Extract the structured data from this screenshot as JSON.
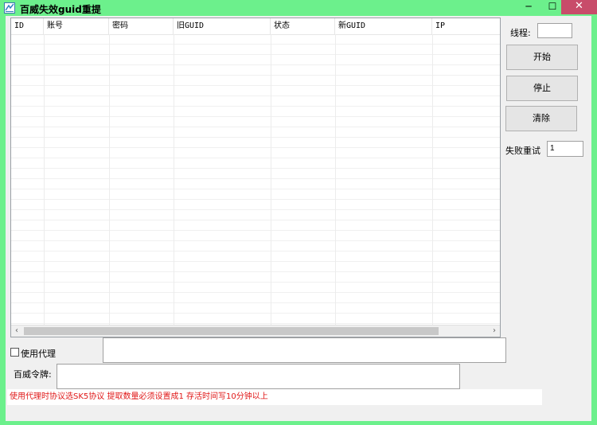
{
  "window": {
    "title": "百威失效guid重提",
    "min_glyph": "─",
    "max_glyph": "☐",
    "close_glyph": "✕"
  },
  "grid": {
    "columns": [
      "ID",
      "账号",
      "密码",
      "旧GUID",
      "状态",
      "新GUID",
      "IP"
    ],
    "rows": []
  },
  "scrollbar": {
    "left_arrow": "‹",
    "right_arrow": "›"
  },
  "controls": {
    "threads_label": "线程:",
    "threads_value": "",
    "start_button": "开始",
    "stop_button": "停止",
    "clear_button": "清除",
    "retry_label": "失败重试",
    "retry_value": "1",
    "use_proxy_label": "使用代理",
    "use_proxy_checked": false,
    "proxy_value": "",
    "token_label": "百威令牌:",
    "token_value": ""
  },
  "note": "使用代理时协议选SK5协议 提取数量必须设置成1 存活时间写10分钟以上",
  "colors": {
    "frame": "#6cf08c",
    "close": "#c84c6a",
    "note_text": "#e01818"
  }
}
